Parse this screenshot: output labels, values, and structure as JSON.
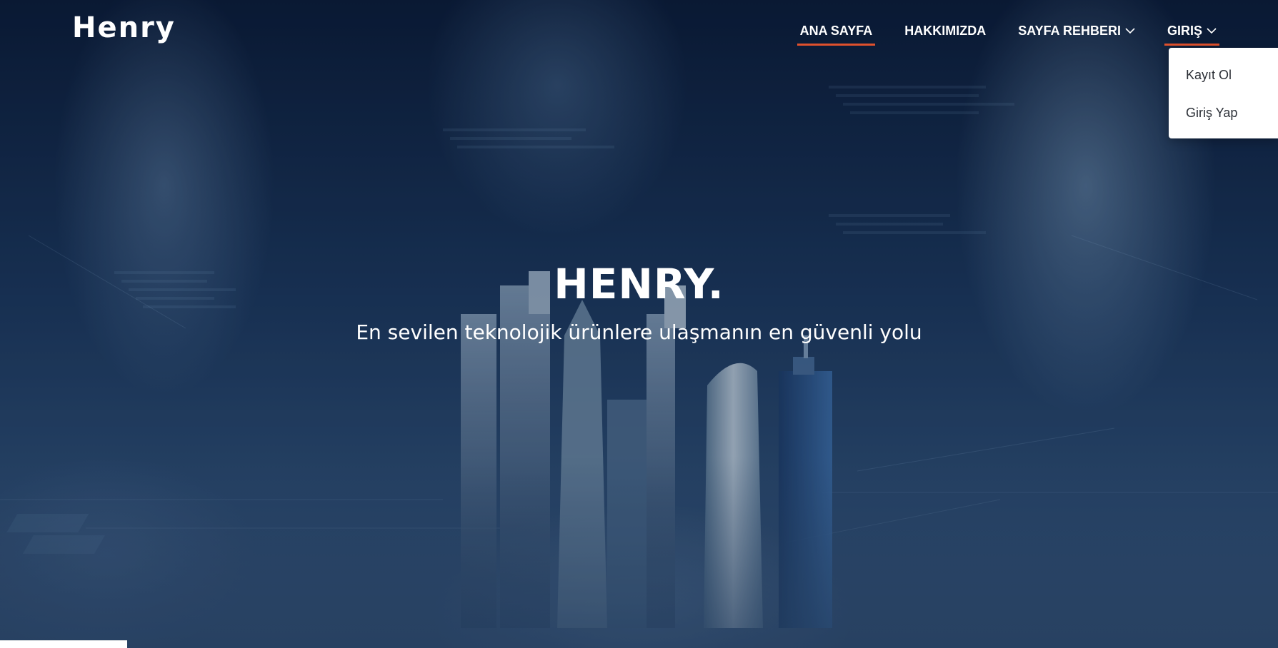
{
  "brand": {
    "logo_text": "Henry"
  },
  "nav": {
    "items": [
      {
        "label": "ANA SAYFA",
        "has_dropdown": false,
        "active": true
      },
      {
        "label": "HAKKIMIZDA",
        "has_dropdown": false,
        "active": false
      },
      {
        "label": "SAYFA REHBERI",
        "has_dropdown": true,
        "active": false
      },
      {
        "label": "GIRIŞ",
        "has_dropdown": true,
        "active": true
      }
    ]
  },
  "dropdown": {
    "items": [
      {
        "label": "Kayıt Ol"
      },
      {
        "label": "Giriş Yap"
      }
    ]
  },
  "hero": {
    "title": "HENRY.",
    "subtitle": "En sevilen teknolojik ürünlere ulaşmanın en güvenli yolu"
  },
  "colors": {
    "accent": "#e0512d",
    "text_light": "#ffffff",
    "background_dark": "#0c1e3a"
  },
  "icons": {
    "chevron": "chevron-down-icon"
  }
}
